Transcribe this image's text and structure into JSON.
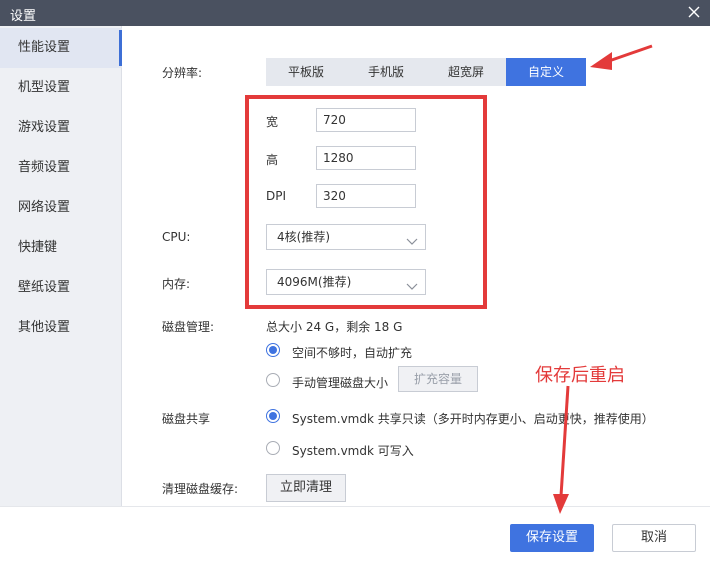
{
  "window": {
    "title": "设置"
  },
  "sidebar": {
    "items": [
      {
        "label": "性能设置",
        "active": true
      },
      {
        "label": "机型设置"
      },
      {
        "label": "游戏设置"
      },
      {
        "label": "音频设置"
      },
      {
        "label": "网络设置"
      },
      {
        "label": "快捷键"
      },
      {
        "label": "壁纸设置"
      },
      {
        "label": "其他设置"
      }
    ]
  },
  "performance": {
    "resolution": {
      "label": "分辨率:",
      "options": [
        "平板版",
        "手机版",
        "超宽屏",
        "自定义"
      ],
      "selected": "自定义"
    },
    "width": {
      "label": "宽",
      "value": "720"
    },
    "height": {
      "label": "高",
      "value": "1280"
    },
    "dpi": {
      "label": "DPI",
      "value": "320"
    },
    "cpu": {
      "label": "CPU:",
      "value": "4核(推荐)"
    },
    "memory": {
      "label": "内存:",
      "value": "4096M(推荐)"
    },
    "disk": {
      "label": "磁盘管理:",
      "info": "总大小 24 G，剩余 18 G",
      "option_auto": "空间不够时，自动扩充",
      "option_manual": "手动管理磁盘大小",
      "expand_button": "扩充容量",
      "selected": "auto"
    },
    "disk_share": {
      "label": "磁盘共享",
      "option_readonly": "System.vmdk 共享只读（多开时内存更小、启动更快，推荐使用）",
      "option_writable": "System.vmdk 可写入",
      "selected": "readonly"
    },
    "cache": {
      "label": "清理磁盘缓存:",
      "button": "立即清理"
    }
  },
  "footer": {
    "save": "保存设置",
    "cancel": "取消"
  },
  "annotation": {
    "text": "保存后重启",
    "color": "#e33a3a"
  },
  "colors": {
    "accent": "#3f73e0",
    "titlebar": "#4a5160",
    "annotation": "#e33a3a"
  }
}
